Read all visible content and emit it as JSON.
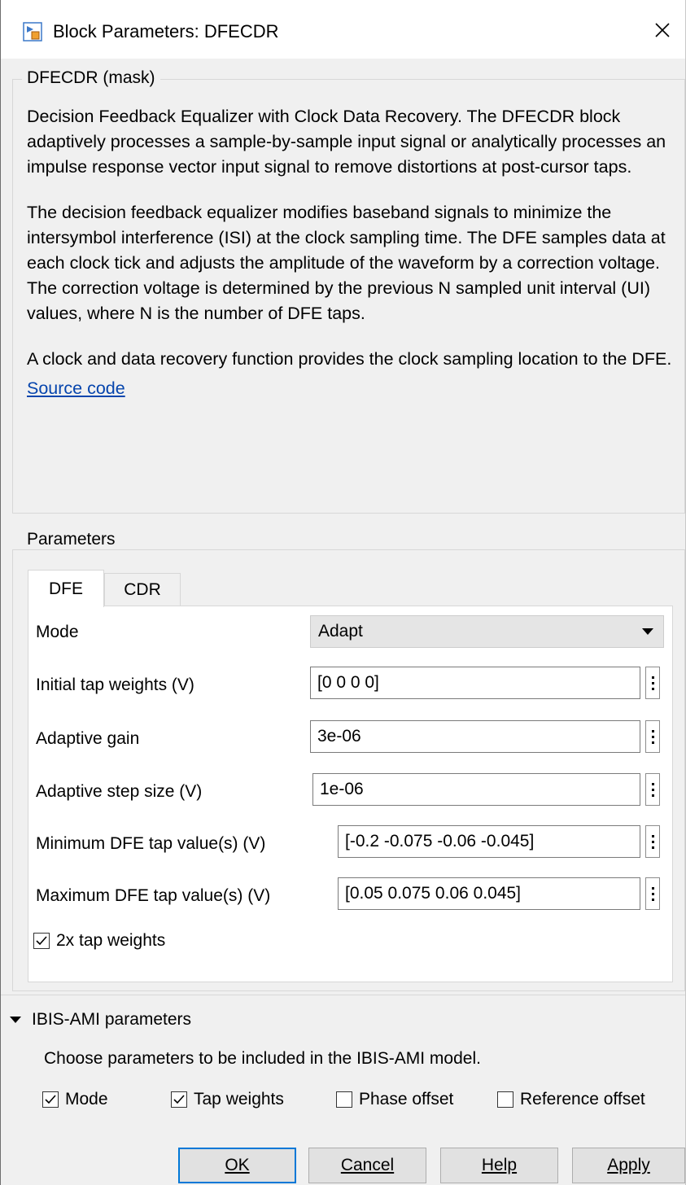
{
  "window": {
    "title": "Block Parameters: DFECDR",
    "close_glyph": "✕"
  },
  "mask": {
    "group_title": "DFECDR (mask)",
    "paragraphs": [
      "Decision Feedback Equalizer with Clock Data Recovery. The DFECDR block adaptively processes a sample-by-sample input signal or analytically processes an impulse response vector input signal to remove distortions at post-cursor taps.",
      "The decision feedback equalizer modifies baseband signals to minimize the intersymbol interference (ISI) at the clock sampling time. The DFE samples data at each clock tick and adjusts the amplitude of the waveform by a correction voltage. The correction voltage is determined by the previous N sampled unit interval (UI) values, where N is the number of DFE taps.",
      "A clock and data recovery function provides the clock sampling location to the DFE."
    ],
    "source_link": "Source code"
  },
  "parameters": {
    "group_title": "Parameters",
    "tabs": [
      {
        "label": "DFE",
        "active": true
      },
      {
        "label": "CDR",
        "active": false
      }
    ],
    "mode": {
      "label": "Mode",
      "value": "Adapt"
    },
    "fields": [
      {
        "label": "Initial tap weights (V)",
        "value": "[0 0 0 0]"
      },
      {
        "label": "Adaptive gain",
        "value": "3e-06"
      },
      {
        "label": "Adaptive step size (V)",
        "value": "1e-06"
      },
      {
        "label": "Minimum DFE tap value(s) (V)",
        "value": "[-0.2 -0.075 -0.06 -0.045]"
      },
      {
        "label": "Maximum DFE tap value(s) (V)",
        "value": "[0.05 0.075 0.06 0.045]"
      }
    ],
    "two_x_tap_weights": {
      "label": "2x tap weights",
      "checked": true
    }
  },
  "ibis": {
    "toggle_label": "IBIS-AMI parameters",
    "description": "Choose parameters to be included in the IBIS-AMI model.",
    "checkboxes": [
      {
        "label": "Mode",
        "checked": true
      },
      {
        "label": "Tap weights",
        "checked": true
      },
      {
        "label": "Phase offset",
        "checked": false
      },
      {
        "label": "Reference offset",
        "checked": false
      }
    ]
  },
  "buttons": {
    "ok": "OK",
    "cancel": "Cancel",
    "help": "Help",
    "apply": "Apply"
  },
  "colors": {
    "link": "#0645ad",
    "default_button_border": "#0078d7",
    "dialog_bg": "#f0f0f0"
  }
}
